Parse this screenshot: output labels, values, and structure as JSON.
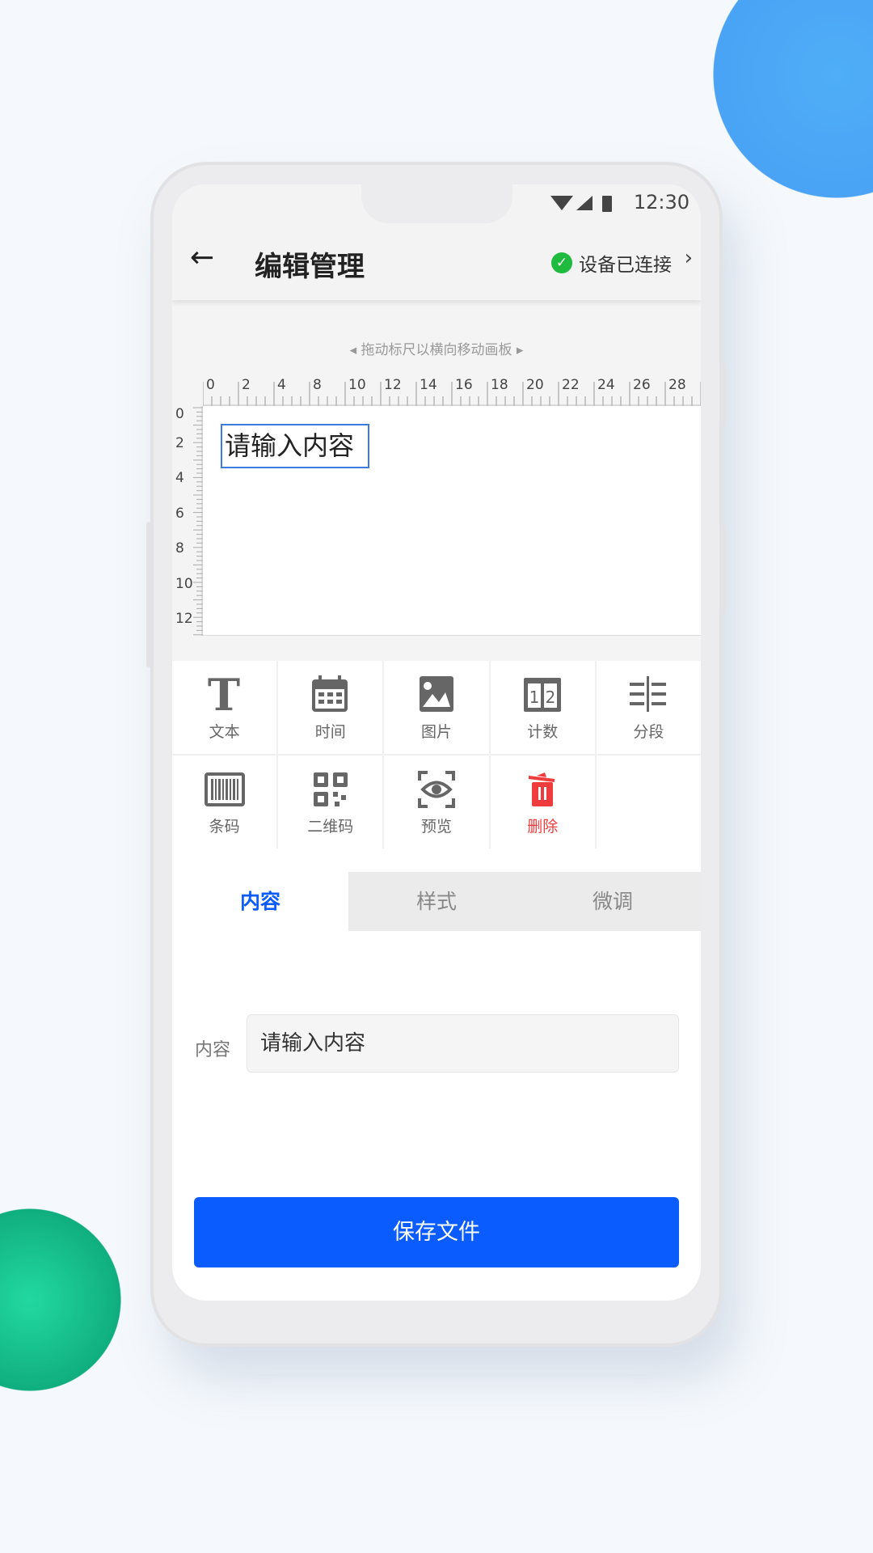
{
  "status_bar": {
    "time": "12:30"
  },
  "header": {
    "title": "编辑管理",
    "device_status": "设备已连接",
    "status_color": "#1fbb3f"
  },
  "canvas": {
    "hint": "拖动标尺以横向移动画板",
    "h_ruler": [
      "0",
      "2",
      "4",
      "8",
      "10",
      "12",
      "14",
      "16",
      "18",
      "20",
      "22",
      "24",
      "26",
      "28"
    ],
    "v_ruler": [
      "0",
      "2",
      "4",
      "6",
      "8",
      "10",
      "12"
    ],
    "text_element": "请输入内容"
  },
  "tools": [
    {
      "label": "文本",
      "icon": "text-icon"
    },
    {
      "label": "时间",
      "icon": "calendar-icon"
    },
    {
      "label": "图片",
      "icon": "image-icon"
    },
    {
      "label": "计数",
      "icon": "counter-icon"
    },
    {
      "label": "分段",
      "icon": "segment-icon"
    },
    {
      "label": "条码",
      "icon": "barcode-icon"
    },
    {
      "label": "二维码",
      "icon": "qrcode-icon"
    },
    {
      "label": "预览",
      "icon": "preview-eye-icon"
    },
    {
      "label": "删除",
      "icon": "trash-icon",
      "color": "#f03c3c"
    }
  ],
  "tabs": [
    {
      "label": "内容",
      "active": true
    },
    {
      "label": "样式"
    },
    {
      "label": "微调"
    }
  ],
  "form": {
    "content_label": "内容",
    "content_value": "请输入内容"
  },
  "save_label": "保存文件",
  "colors": {
    "accent": "#0a5cff",
    "danger": "#f03c3c"
  }
}
